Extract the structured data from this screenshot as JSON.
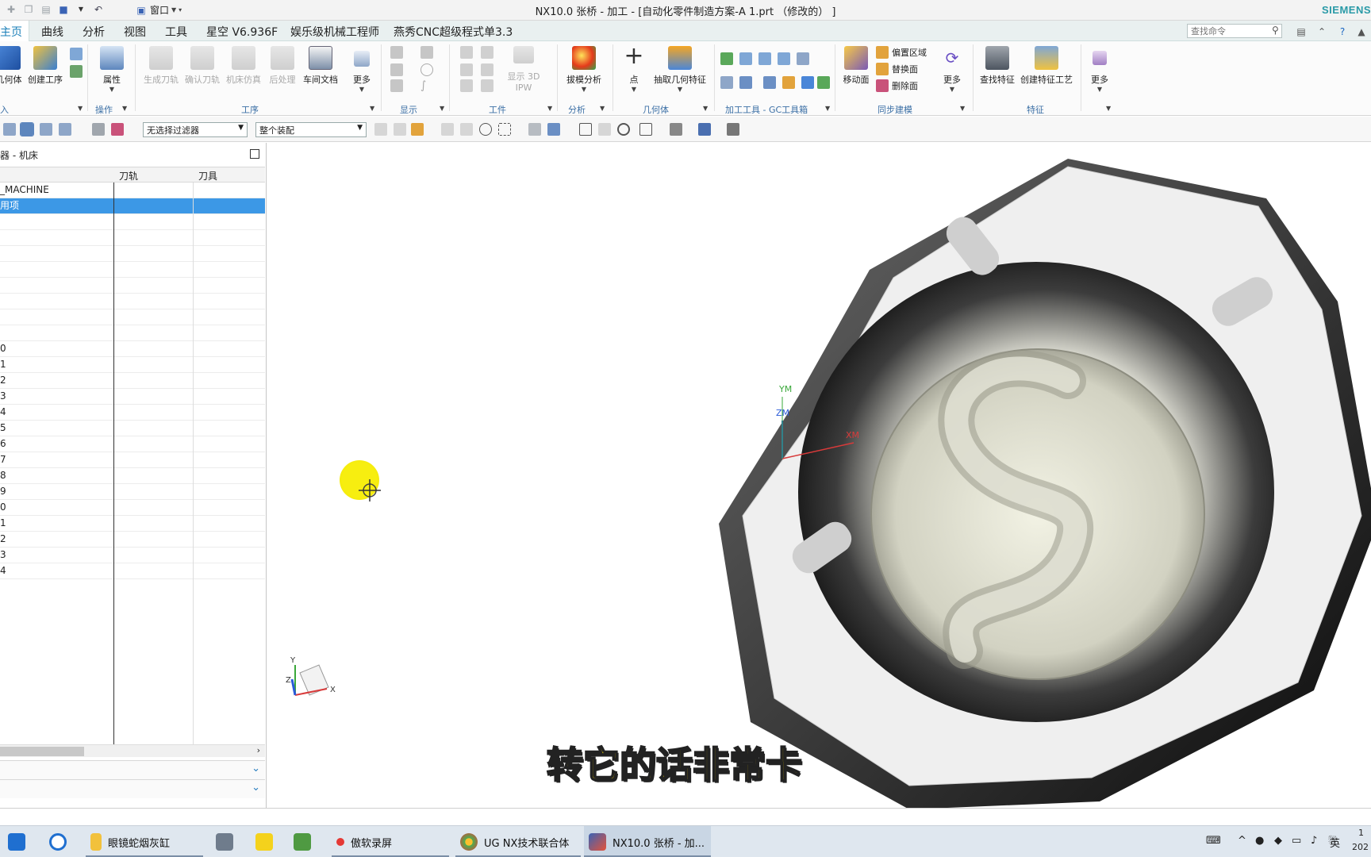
{
  "titlebar": {
    "window_menu": "窗口",
    "title": "NX10.0 张桥 - 加工 - [自动化零件制造方案-A 1.prt （修改的） ]",
    "brand": "SIEMENS"
  },
  "menu": {
    "tabs": [
      "主页",
      "曲线",
      "分析",
      "视图",
      "工具",
      "星空 V6.936F",
      "娱乐级机械工程师",
      "燕秀CNC超级程式单3.3"
    ],
    "search_placeholder": "查找命令"
  },
  "ribbon": {
    "buttons": {
      "geometry": "几何体",
      "create_op": "创建工序",
      "properties": "属性",
      "gen_toolpath": "生成刀轨",
      "verify": "确认刀轨",
      "simulate": "机床仿真",
      "postprocess": "后处理",
      "shop_doc": "车间文档",
      "more1": "更多",
      "show_ipw": "显示 3D IPW",
      "draft_analysis": "拔模分析",
      "point": "点",
      "extract_geom": "抽取几何特征",
      "move_face": "移动面",
      "offset_region": "偏置区域",
      "replace_face": "替换面",
      "delete_face": "删除面",
      "more2": "更多",
      "find_feature": "查找特征",
      "create_feature_process": "创建特征工艺",
      "more3": "更多"
    },
    "groups": {
      "insert": "入",
      "operations": "操作",
      "process": "工序",
      "display": "显示",
      "workpiece": "工件",
      "analysis": "分析",
      "geometry": "几何体",
      "gc_tools": "加工工具 - GC工具箱",
      "sync_modeling": "同步建模",
      "feature": "特征"
    }
  },
  "toolbar2": {
    "filter": "无选择过滤器",
    "assembly": "整个装配"
  },
  "navigator": {
    "title": "器 - 机床",
    "columns": [
      "刀轨",
      "刀具"
    ],
    "rows": [
      "_MACHINE",
      "用项",
      "",
      "",
      "",
      "",
      "",
      "",
      "",
      "",
      "0",
      "1",
      "2",
      "3",
      "4",
      "5",
      "6",
      "7",
      "8",
      "9",
      "0",
      "1",
      "2",
      "3",
      "4"
    ]
  },
  "viewport": {
    "subtitle": "转它的话非常卡",
    "wcs": {
      "zm": "ZM",
      "xm": "XM",
      "ym": "YM"
    },
    "triad": {
      "y": "Y",
      "z": "Z",
      "x": "X"
    }
  },
  "taskbar": {
    "items": [
      "眼镜蛇烟灰缸",
      "傲软录屏",
      "UG NX技术联合体",
      "NX10.0 张桥 - 加..."
    ],
    "ime": "英",
    "clock_top": "1",
    "clock_bottom": "202"
  },
  "colors": {
    "accent": "#1a7fb8",
    "selection": "#3c98e6",
    "subtitle": "#f6d400",
    "brand": "#2a9aa7"
  }
}
